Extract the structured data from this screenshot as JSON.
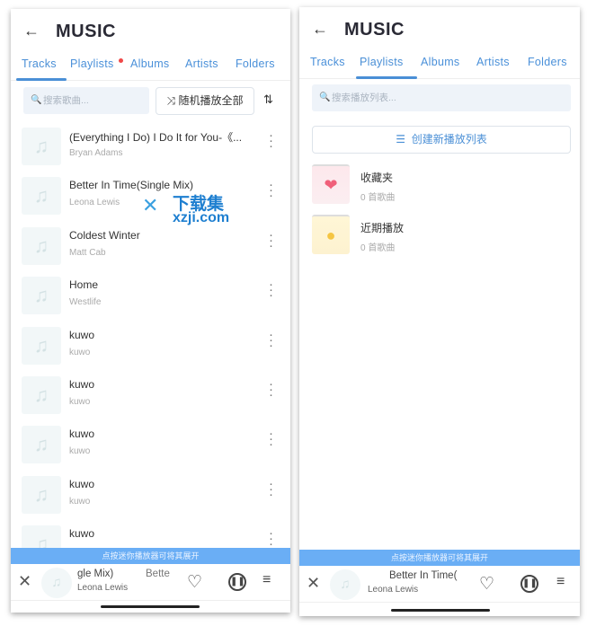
{
  "left": {
    "back_icon": "arrow-left",
    "title": "MUSIC",
    "tabs": [
      {
        "label": "Tracks"
      },
      {
        "label": "Playlists"
      },
      {
        "label": "Albums"
      },
      {
        "label": "Artists"
      },
      {
        "label": "Folders"
      }
    ],
    "active_tab": "Tracks",
    "search_placeholder": "搜索歌曲...",
    "shuffle_label": "随机播放全部",
    "tracks": [
      {
        "title": "(Everything I Do) I Do It for You-《...",
        "artist": "Bryan Adams"
      },
      {
        "title": "Better In Time(Single Mix)",
        "artist": "Leona Lewis"
      },
      {
        "title": "Coldest Winter",
        "artist": "Matt Cab"
      },
      {
        "title": "Home",
        "artist": "Westlife"
      },
      {
        "title": "kuwo",
        "artist": "kuwo"
      },
      {
        "title": "kuwo",
        "artist": "kuwo"
      },
      {
        "title": "kuwo",
        "artist": "kuwo"
      },
      {
        "title": "kuwo",
        "artist": "kuwo"
      },
      {
        "title": "kuwo",
        "artist": ""
      }
    ],
    "banner": "点按迷你播放器可将其展开",
    "player": {
      "title": "gle Mix)",
      "title2": "Bette",
      "artist": "Leona Lewis"
    }
  },
  "right": {
    "title": "MUSIC",
    "tabs": [
      {
        "label": "Tracks"
      },
      {
        "label": "Playlists"
      },
      {
        "label": "Albums"
      },
      {
        "label": "Artists"
      },
      {
        "label": "Folders"
      }
    ],
    "active_tab": "Playlists",
    "search_placeholder": "搜索播放列表...",
    "create_label": "创建新播放列表",
    "playlists": [
      {
        "name": "收藏夹",
        "count": "0 首歌曲",
        "icon": "heart",
        "color": "#f0607a"
      },
      {
        "name": "近期播放",
        "count": "0 首歌曲",
        "icon": "clock",
        "color": "#f5c542"
      }
    ],
    "banner": "点按迷你播放器可将其展开",
    "player": {
      "title": "Better In Time(",
      "artist": "Leona Lewis"
    }
  },
  "watermark": {
    "text1": "下载集",
    "text2": "xzji.com"
  },
  "colors": {
    "accent": "#4a8fd6",
    "banner": "#6aaef5",
    "badge": "#f04848"
  }
}
